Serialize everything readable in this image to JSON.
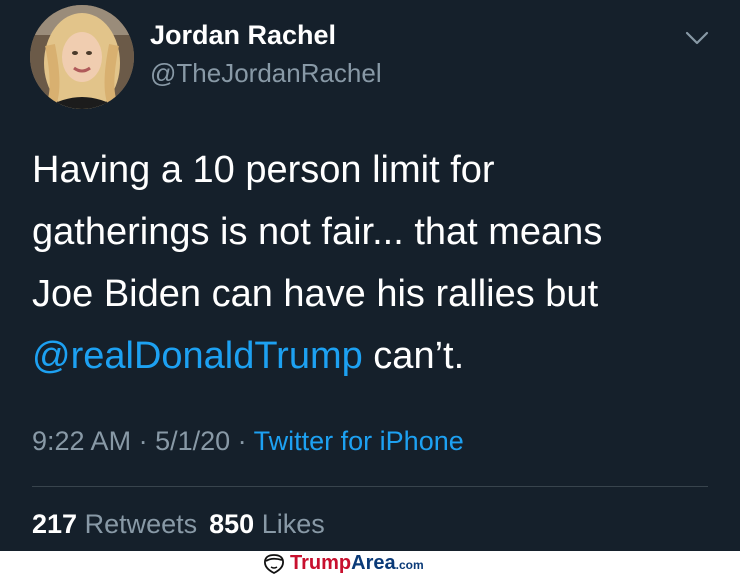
{
  "user": {
    "display_name": "Jordan Rachel",
    "handle": "@TheJordanRachel",
    "avatar_icon": "profile-photo"
  },
  "menu": {
    "icon": "chevron-down-icon"
  },
  "tweet": {
    "lines": [
      "Having a 10 person limit for",
      "gatherings is not fair... that means",
      "Joe Biden can have his rallies but"
    ],
    "mention": "@realDonaldTrump",
    "tail": " can’t."
  },
  "meta": {
    "time": "9:22 AM",
    "sep1": " · ",
    "date": "5/1/20",
    "sep2": " · ",
    "source": "Twitter for iPhone"
  },
  "stats": {
    "retweets_count": "217",
    "retweets_label": " Retweets",
    "likes_count": "850",
    "likes_label": " Likes"
  },
  "watermark": {
    "part1": "Trump",
    "part2": "Area",
    "part3": ".com",
    "logo_icon": "trump-hair-logo-icon"
  },
  "colors": {
    "background": "#15202b",
    "text": "#ffffff",
    "secondary": "#8899a6",
    "link": "#1da1f2",
    "watermark_red": "#c8102e",
    "watermark_blue": "#0a3a78"
  }
}
